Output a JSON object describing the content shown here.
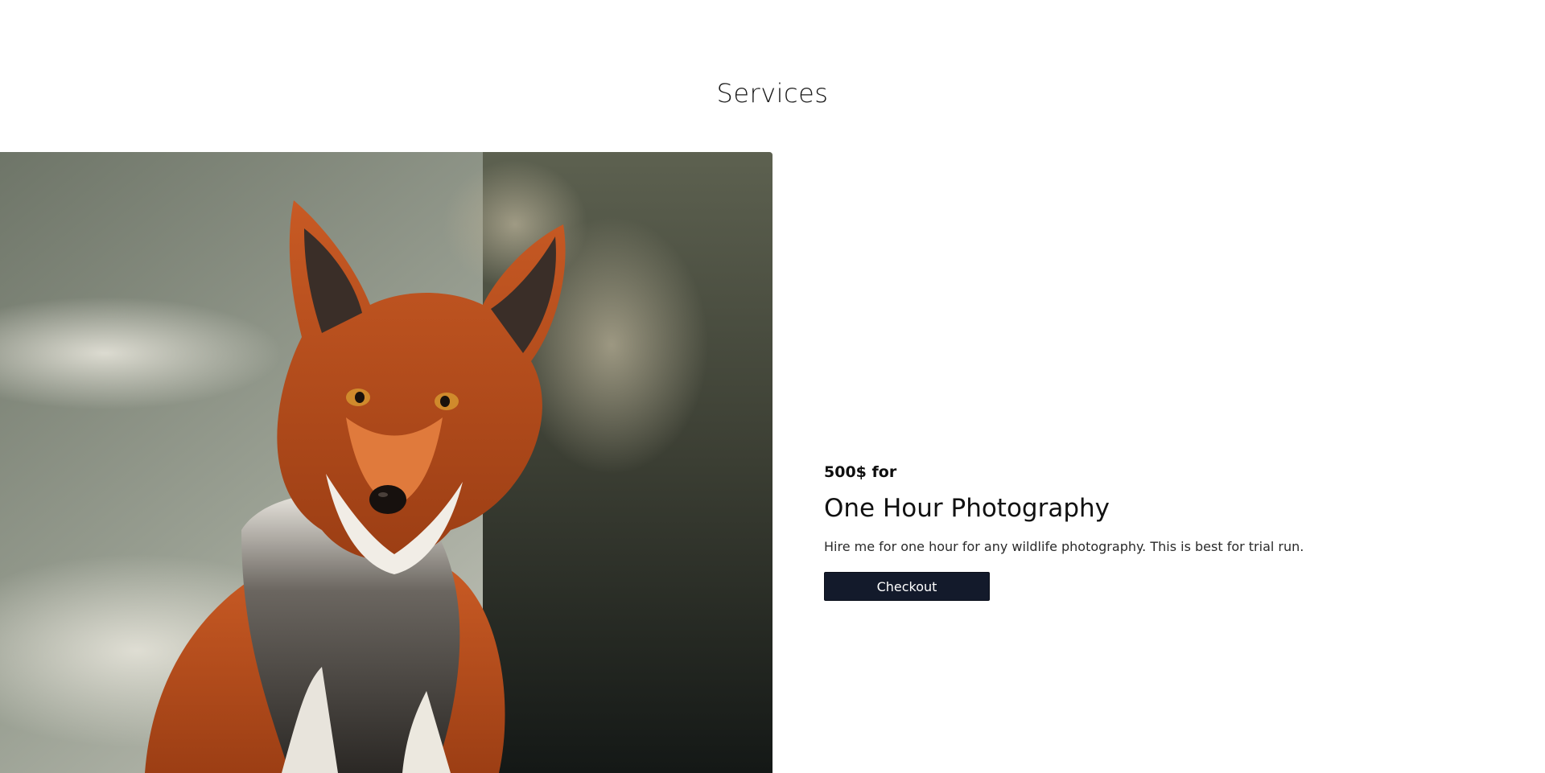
{
  "section": {
    "title": "Services"
  },
  "service": {
    "price_label": "500$ for",
    "name": "One Hour Photography",
    "description": "Hire me for one hour for any wildlife photography. This is best for trial run.",
    "checkout_label": "Checkout",
    "image_subject": "red fox photograph"
  },
  "colors": {
    "button_bg": "#131a2b",
    "button_text": "#ffffff",
    "page_bg": "#ffffff"
  }
}
